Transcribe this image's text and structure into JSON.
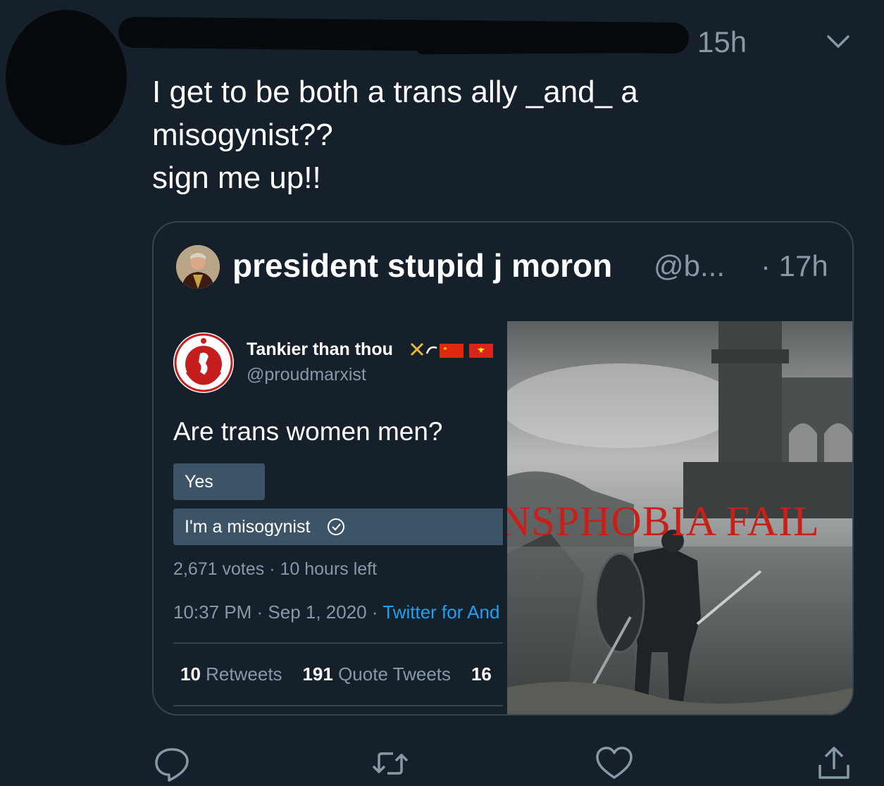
{
  "tweet": {
    "timestamp": "15h",
    "text": "I get to be both a trans ally _and_ a\nmisogynist??\nsign me up!!"
  },
  "quote": {
    "display_name": "president stupid j moron",
    "handle": "@b...",
    "time": "· 17h",
    "embedded_tweet": {
      "display_name": "Tankier than thou",
      "handle": "@proudmarxist",
      "question": "Are trans women men?",
      "options": [
        "Yes",
        "I'm a misogynist"
      ],
      "selected_option": "I'm a misogynist",
      "votes": "2,671 votes · 10 hours left",
      "date_prefix": "10:37 PM · Sep 1, 2020 · ",
      "source": "Twitter for And",
      "stats": {
        "retweets_count": "10",
        "retweets_label": "Retweets",
        "quotes_count": "191",
        "quotes_label": "Quote Tweets",
        "likes_count": "16"
      }
    },
    "image_caption": "NSPHOBIA FAIL"
  },
  "actions": [
    "reply-icon",
    "retweet-icon",
    "like-icon",
    "share-icon"
  ],
  "colors": {
    "background": "#15202b",
    "muted": "#8899a6",
    "link": "#1da1f2",
    "poll_bar": "#3d5466",
    "caption": "#c62018"
  }
}
